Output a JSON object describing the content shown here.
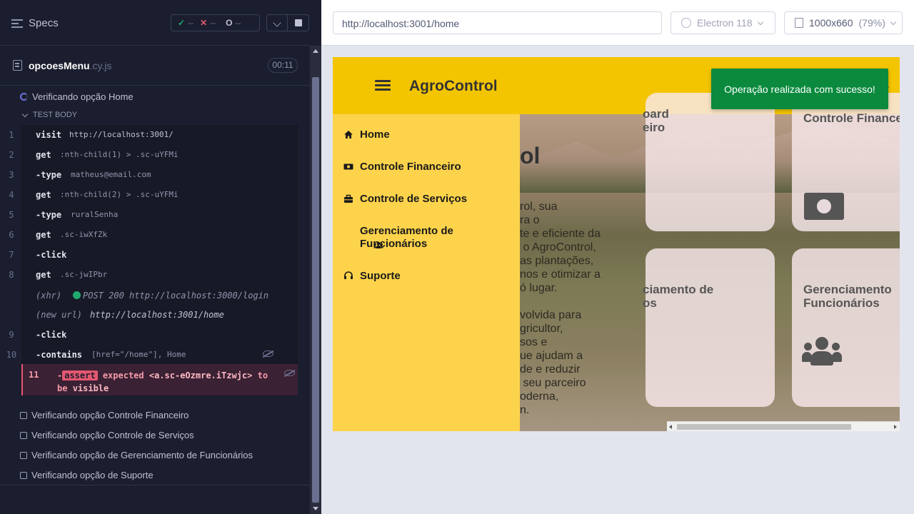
{
  "runner": {
    "specs_label": "Specs",
    "stats": {
      "passed": "--",
      "failed": "--",
      "pending": "--"
    },
    "file": {
      "name": "opcoesMenu",
      "ext": ".cy.js",
      "duration": "00:11"
    },
    "running_test": "Verificando opção Home",
    "test_body_label": "TEST BODY",
    "commands": [
      {
        "num": "1",
        "name": "visit",
        "arg": "http://localhost:3001/"
      },
      {
        "num": "2",
        "name": "get",
        "arg": ":nth-child(1) > .sc-uYFMi"
      },
      {
        "num": "3",
        "name": "-type",
        "arg": "matheus@email.com"
      },
      {
        "num": "4",
        "name": "get",
        "arg": ":nth-child(2) > .sc-uYFMi"
      },
      {
        "num": "5",
        "name": "-type",
        "arg": "ruralSenha"
      },
      {
        "num": "6",
        "name": "get",
        "arg": ".sc-iwXfZk"
      },
      {
        "num": "7",
        "name": "-click",
        "arg": ""
      },
      {
        "num": "8",
        "name": "get",
        "arg": ".sc-jwIPbr"
      },
      {
        "num": "",
        "name": "(xhr)",
        "arg": "POST 200 http://localhost:3000/login"
      },
      {
        "num": "",
        "name": "(new url)",
        "arg": "http://localhost:3001/home"
      },
      {
        "num": "9",
        "name": "-click",
        "arg": ""
      },
      {
        "num": "10",
        "name": "-contains",
        "arg": "[href=\"/home\"], Home"
      }
    ],
    "failed_cmd": {
      "num": "11",
      "dash": "-",
      "tag": "assert",
      "text": "expected",
      "subject": "<a.sc-eOzmre.iTzwjc>",
      "to": "to",
      "be": "be",
      "visible": "visible"
    },
    "other_tests": [
      "Verificando opção Controle Financeiro",
      "Verificando opção Controle de Serviços",
      "Verificando opção de Gerenciamento de Funcionários",
      "Verificando opção de Suporte"
    ]
  },
  "browser": {
    "url": "http://localhost:3001/home",
    "name": "Electron 118",
    "viewport": "1000x660",
    "zoom": "(79%)"
  },
  "app": {
    "brand": "AgroControl",
    "toast": "Operação realizada com sucesso!",
    "menu": [
      {
        "icon": "home-icon",
        "label": "Home"
      },
      {
        "icon": "money-icon",
        "label": "Controle Financeiro"
      },
      {
        "icon": "briefcase-icon",
        "label": "Controle de Serviços"
      },
      {
        "icon": "users-icon",
        "label": "Gerenciamento de\nFuncionários"
      },
      {
        "icon": "headset-icon",
        "label": "Suporte"
      }
    ],
    "hero_title_fragment": "ol",
    "hero_lines_1": "rol, sua\nra o\nte e eficiente da\n o AgroControl,\nas plantações,\nnos e otimizar a\nó lugar.",
    "hero_lines_2": "volvida para\ngricultor,\nsos e\nue ajudam a\nde e reduzir\n seu parceiro\noderna,\nn.",
    "cards": [
      {
        "title": "oard\neiro"
      },
      {
        "title": "Controle Finance"
      },
      {
        "title": "ciamento de\nos"
      },
      {
        "title": "Gerenciamento\nFuncionários"
      }
    ]
  },
  "colors": {
    "header": "#f3c500",
    "menu": "#fdd34b",
    "toast": "#0b8a3e",
    "fail": "#e45770"
  }
}
